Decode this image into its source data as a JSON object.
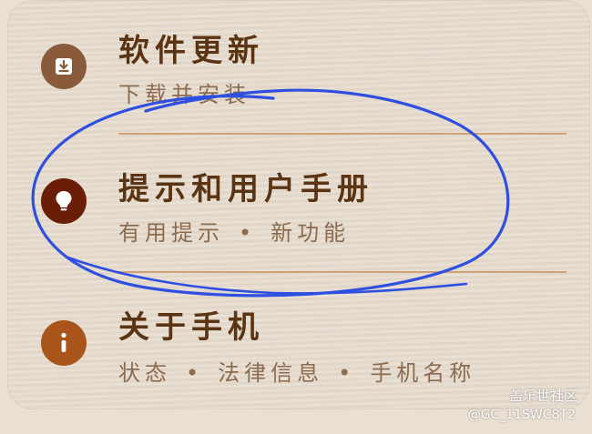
{
  "items": [
    {
      "title": "软件更新",
      "subtitle_parts": [
        "下载并安装"
      ],
      "icon": "download-icon",
      "icon_color": "#8a5b3a"
    },
    {
      "title": "提示和用户手册",
      "subtitle_parts": [
        "有用提示",
        "新功能"
      ],
      "icon": "lightbulb-icon",
      "icon_color": "#6b1e07"
    },
    {
      "title": "关于手机",
      "subtitle_parts": [
        "状态",
        "法律信息",
        "手机名称"
      ],
      "icon": "info-icon",
      "icon_color": "#a8541a"
    }
  ],
  "separator": "•",
  "annotation_color": "#2f4fe0",
  "watermark": {
    "title": "盖乐世社区",
    "id": "@GC_11SWC8T2"
  }
}
